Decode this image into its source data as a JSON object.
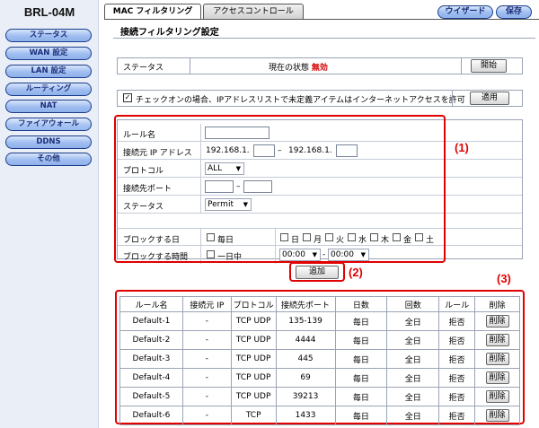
{
  "sidebar": {
    "model": "BRL-04M",
    "items": [
      {
        "label": "ステータス"
      },
      {
        "label": "WAN 設定"
      },
      {
        "label": "LAN 設定"
      },
      {
        "label": "ルーティング"
      },
      {
        "label": "NAT"
      },
      {
        "label": "ファイアウォール"
      },
      {
        "label": "DDNS"
      },
      {
        "label": "その他"
      }
    ]
  },
  "tabs": [
    {
      "label": "MAC フィルタリング"
    },
    {
      "label": "アクセスコントロール"
    }
  ],
  "header": {
    "wizard_label": "ウイザード",
    "save_label": "保存"
  },
  "section_title": "接続フィルタリング設定",
  "status": {
    "label": "ステータス",
    "current_text": "現在の状態",
    "current_value": "無効",
    "start_label": "開始"
  },
  "allow": {
    "checked_glyph": "✓",
    "label": "チェックオンの場合、IPアドレスリストで未定義アイテムはインターネットアクセスを許可",
    "apply_label": "適用"
  },
  "form": {
    "rule_name_label": "ルール名",
    "src_ip_label": "接続元 IP アドレス",
    "ip_prefix_1": "192.168.1.",
    "ip_dash": "–",
    "ip_prefix_2": "192.168.1.",
    "protocol_label": "プロトコル",
    "protocol_value": "ALL",
    "port_label": "接続先ポート",
    "port_dash": "–",
    "status_label": "ステータス",
    "status_value": "Permit",
    "block_day_label": "ブロックする日",
    "everyday_label": "毎日",
    "days": [
      "日",
      "月",
      "火",
      "水",
      "木",
      "金",
      "土"
    ],
    "block_time_label": "ブロックする時間",
    "allday_label": "一日中",
    "time_start": "00:00",
    "time_sep": "-",
    "time_end": "00:00",
    "dropdown_glyph": "▼"
  },
  "add_label": "追加",
  "annotations": {
    "one": "(1)",
    "two": "(2)",
    "three": "(3)"
  },
  "table": {
    "headers": [
      "ルール名",
      "接続元 IP",
      "プロトコル",
      "接続先ポート",
      "日数",
      "回数",
      "ルール",
      "削除"
    ],
    "delete_label": "削除",
    "rows": [
      {
        "name": "Default-1",
        "src": "-",
        "proto": "TCP UDP",
        "port": "135-139",
        "days": "毎日",
        "times": "全日",
        "rule": "拒否"
      },
      {
        "name": "Default-2",
        "src": "-",
        "proto": "TCP UDP",
        "port": "4444",
        "days": "毎日",
        "times": "全日",
        "rule": "拒否"
      },
      {
        "name": "Default-3",
        "src": "-",
        "proto": "TCP UDP",
        "port": "445",
        "days": "毎日",
        "times": "全日",
        "rule": "拒否"
      },
      {
        "name": "Default-4",
        "src": "-",
        "proto": "TCP UDP",
        "port": "69",
        "days": "毎日",
        "times": "全日",
        "rule": "拒否"
      },
      {
        "name": "Default-5",
        "src": "-",
        "proto": "TCP UDP",
        "port": "39213",
        "days": "毎日",
        "times": "全日",
        "rule": "拒否"
      },
      {
        "name": "Default-6",
        "src": "-",
        "proto": "TCP",
        "port": "1433",
        "days": "毎日",
        "times": "全日",
        "rule": "拒否"
      }
    ]
  },
  "colors": {
    "accent_red": "#e10000",
    "status_off": "#d40000",
    "nav_blue": "#9fbdf0"
  }
}
